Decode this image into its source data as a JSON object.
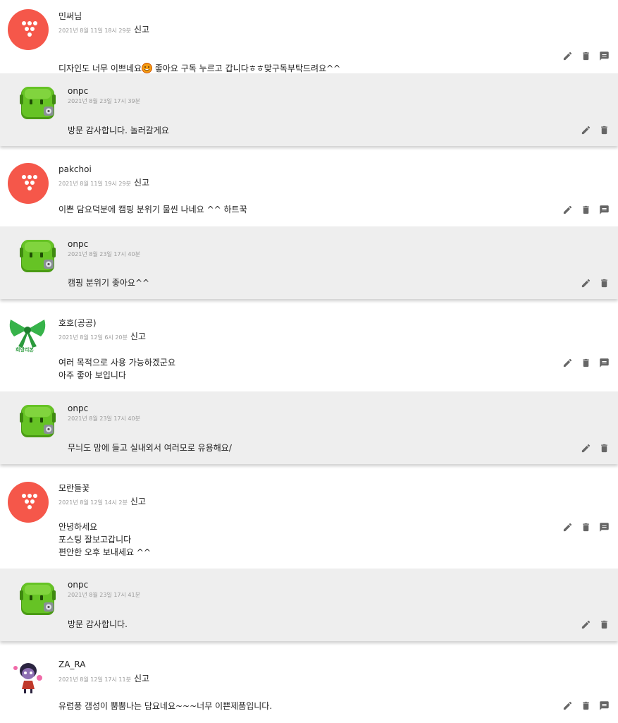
{
  "report_label": "신고",
  "comments": [
    {
      "author": "민써님",
      "date": "2021년 8월 11일 18시 29분",
      "text": "디자인도 너무 이쁘네요",
      "text_after_emoji": " 좋아요 구독 누르고 갑니다ㅎㅎ맞구독부탁드려요^^",
      "reply": {
        "author": "onpc",
        "date": "2021년 8월 23일 17시 39분",
        "text": "방문 감사합니다. 놀러갈게요"
      }
    },
    {
      "author": "pakchoi",
      "date": "2021년 8월 11일 19시 29분",
      "text": "이쁜 담요덕분에 캠핑 분위기 물씬 나네요 ^^ 하트꾹",
      "reply": {
        "author": "onpc",
        "date": "2021년 8월 23일 17시 40분",
        "text": "캠핑 분위기 좋아요^^"
      }
    },
    {
      "author": "호호(공공)",
      "date": "2021년 8월 12일 6시 20분",
      "avatar_caption": "희망리본",
      "text": "여러 목적으로 사용 가능하겠군요\n아주 좋아 보입니다",
      "reply": {
        "author": "onpc",
        "date": "2021년 8월 23일 17시 40분",
        "text": "무늬도 맘에 들고 실내외서 여러모로 유용해요/"
      }
    },
    {
      "author": "모란들꽃",
      "date": "2021년 8월 12일 14시 2분",
      "text": "안녕하세요\n포스팅 잘보고갑니다\n편안한 오후 보내세요 ^^",
      "reply": {
        "author": "onpc",
        "date": "2021년 8월 23일 17시 41분",
        "text": "방문 감사합니다."
      }
    },
    {
      "author": "ZA_RA",
      "date": "2021년 8월 12일 17시 11분",
      "text": "유럽풍 갬성이 뿜뿜나는 담요네요~~~너무 이쁜제품입니다."
    }
  ],
  "colors": {
    "tistory_red": "#f5574a",
    "reply_bg": "#eeeeee",
    "icon": "#666666",
    "onpc_green": "#5cbf1f"
  },
  "icons": {
    "edit": "pencil-icon",
    "delete": "trash-icon",
    "reply": "reply-icon"
  }
}
